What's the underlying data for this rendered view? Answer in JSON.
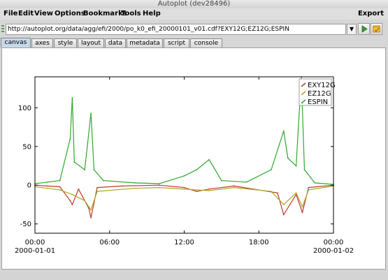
{
  "window": {
    "title": "Autoplot (dev28496)"
  },
  "menu": {
    "items": [
      "File",
      "Edit",
      "View",
      "Options",
      "Bookmarks",
      "Tools",
      "Help"
    ],
    "export": "Export"
  },
  "url": {
    "value": "http://autoplot.org/data/agg/efi/2000/po_k0_efi_20000101_v01.cdf?EXY12G;EZ12G;ESPIN"
  },
  "tabs": [
    "canvas",
    "axes",
    "style",
    "layout",
    "data",
    "metadata",
    "script",
    "console"
  ],
  "active_tab": "canvas",
  "colors": {
    "exy12g": "#c0392b",
    "ez12g": "#a8a824",
    "espin": "#2ea82e"
  },
  "icons": {
    "go": "play-icon",
    "bookmark": "bookmark-icon",
    "dropdown": "chevron-down-icon",
    "grip": "drag-handle-icon"
  },
  "chart_data": {
    "type": "line",
    "x_unit": "time",
    "xlim": [
      "2000-01-01T00:00",
      "2000-01-02T00:00"
    ],
    "ylim": [
      -62,
      140
    ],
    "yticks": [
      -50,
      0,
      50,
      100
    ],
    "ytick_labels": [
      "-50",
      "0",
      "50",
      "100"
    ],
    "xticks": [
      "2000-01-01T00:00",
      "2000-01-01T06:00",
      "2000-01-01T12:00",
      "2000-01-01T18:00",
      "2000-01-02T00:00"
    ],
    "xtick_labels": [
      "00:00",
      "06:00",
      "12:00",
      "18:00",
      "00:00"
    ],
    "xtick_sublabels": [
      "2000-01-01",
      "",
      "",
      "",
      "2000-01-02"
    ],
    "legend": "top-right",
    "grid": false,
    "series": [
      {
        "name": "EXY12G",
        "color": "#c0392b",
        "points": [
          [
            "2000-01-01T00:00",
            0
          ],
          [
            "2000-01-01T01:00",
            -1
          ],
          [
            "2000-01-01T02:00",
            -2
          ],
          [
            "2000-01-01T02:50",
            -20
          ],
          [
            "2000-01-01T03:00",
            -25
          ],
          [
            "2000-01-01T03:30",
            -5
          ],
          [
            "2000-01-01T04:20",
            -30
          ],
          [
            "2000-01-01T04:30",
            -42
          ],
          [
            "2000-01-01T05:00",
            -3
          ],
          [
            "2000-01-01T07:00",
            -1
          ],
          [
            "2000-01-01T10:00",
            0
          ],
          [
            "2000-01-01T12:00",
            -3
          ],
          [
            "2000-01-01T13:00",
            -8
          ],
          [
            "2000-01-01T14:00",
            -5
          ],
          [
            "2000-01-01T16:00",
            -1
          ],
          [
            "2000-01-01T19:30",
            -10
          ],
          [
            "2000-01-01T20:00",
            -38
          ],
          [
            "2000-01-01T21:00",
            -12
          ],
          [
            "2000-01-01T21:30",
            -35
          ],
          [
            "2000-01-01T22:00",
            -3
          ],
          [
            "2000-01-02T00:00",
            0
          ]
        ]
      },
      {
        "name": "EZ12G",
        "color": "#a8a824",
        "points": [
          [
            "2000-01-01T00:00",
            -2
          ],
          [
            "2000-01-01T01:00",
            -4
          ],
          [
            "2000-01-01T02:00",
            -6
          ],
          [
            "2000-01-01T03:00",
            -12
          ],
          [
            "2000-01-01T04:00",
            -20
          ],
          [
            "2000-01-01T04:30",
            -32
          ],
          [
            "2000-01-01T05:00",
            -8
          ],
          [
            "2000-01-01T08:00",
            -4
          ],
          [
            "2000-01-01T10:00",
            -3
          ],
          [
            "2000-01-01T12:00",
            -5
          ],
          [
            "2000-01-01T14:00",
            -7
          ],
          [
            "2000-01-01T16:00",
            -3
          ],
          [
            "2000-01-01T19:00",
            -8
          ],
          [
            "2000-01-01T20:00",
            -25
          ],
          [
            "2000-01-01T21:00",
            -10
          ],
          [
            "2000-01-01T21:30",
            -28
          ],
          [
            "2000-01-01T22:00",
            -6
          ],
          [
            "2000-01-02T00:00",
            -1
          ]
        ]
      },
      {
        "name": "ESPIN",
        "color": "#2ea82e",
        "points": [
          [
            "2000-01-01T00:00",
            2
          ],
          [
            "2000-01-01T01:00",
            4
          ],
          [
            "2000-01-01T02:00",
            6
          ],
          [
            "2000-01-01T02:50",
            60
          ],
          [
            "2000-01-01T03:00",
            113
          ],
          [
            "2000-01-01T03:10",
            30
          ],
          [
            "2000-01-01T04:00",
            20
          ],
          [
            "2000-01-01T04:30",
            93
          ],
          [
            "2000-01-01T04:45",
            20
          ],
          [
            "2000-01-01T05:30",
            6
          ],
          [
            "2000-01-01T08:00",
            3
          ],
          [
            "2000-01-01T10:00",
            2
          ],
          [
            "2000-01-01T12:00",
            12
          ],
          [
            "2000-01-01T13:00",
            20
          ],
          [
            "2000-01-01T14:00",
            33
          ],
          [
            "2000-01-01T15:00",
            6
          ],
          [
            "2000-01-01T17:00",
            4
          ],
          [
            "2000-01-01T19:00",
            20
          ],
          [
            "2000-01-01T20:00",
            70
          ],
          [
            "2000-01-01T20:20",
            35
          ],
          [
            "2000-01-01T21:00",
            25
          ],
          [
            "2000-01-01T21:25",
            140
          ],
          [
            "2000-01-01T21:40",
            20
          ],
          [
            "2000-01-01T22:30",
            3
          ],
          [
            "2000-01-02T00:00",
            1
          ]
        ]
      }
    ]
  }
}
